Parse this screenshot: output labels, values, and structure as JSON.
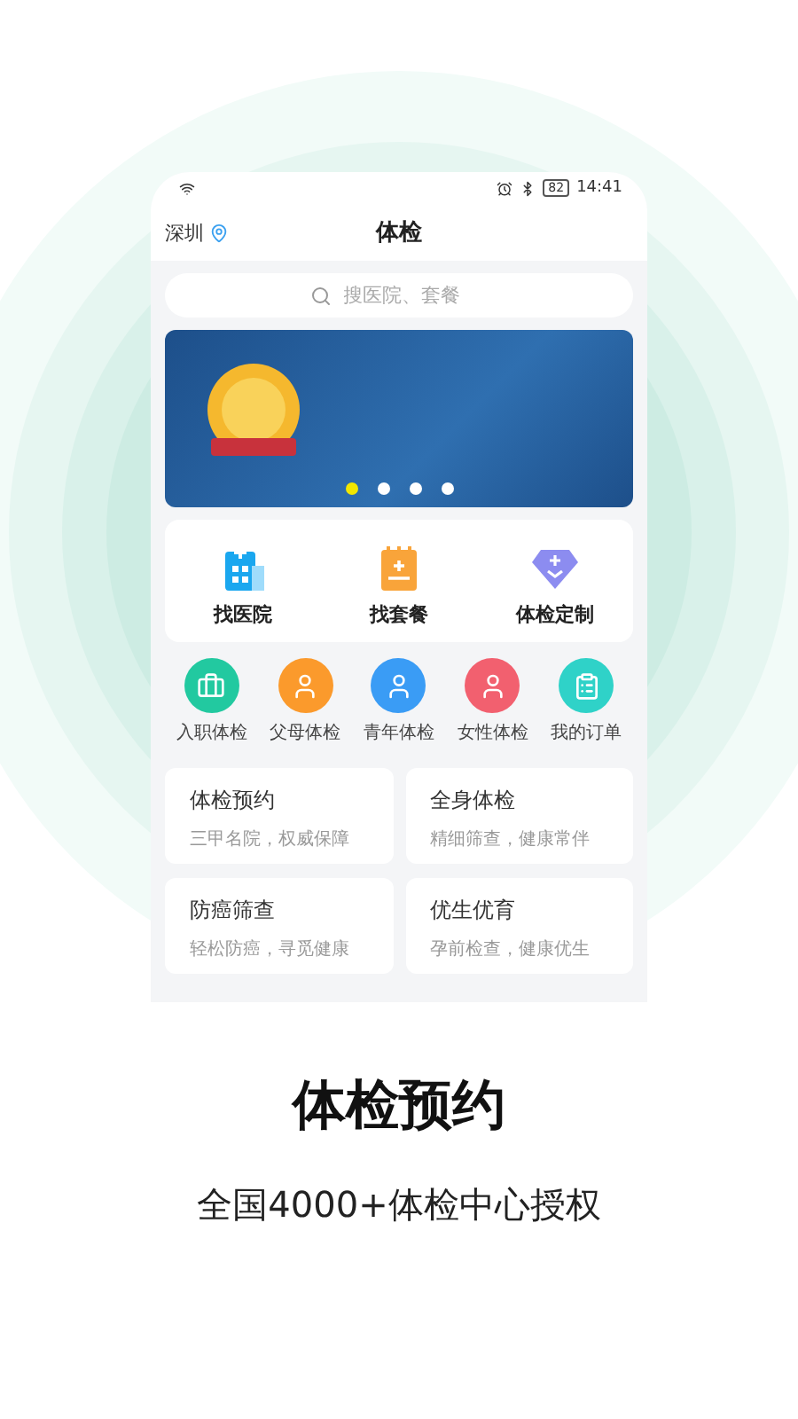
{
  "status_bar": {
    "battery": "82",
    "time": "14:41"
  },
  "header": {
    "city": "深圳",
    "title": "体检"
  },
  "search": {
    "placeholder": "搜医院、套餐"
  },
  "banner": {
    "dots": [
      {
        "selected": true
      },
      {
        "selected": false
      },
      {
        "selected": false
      },
      {
        "selected": false
      }
    ]
  },
  "quick_actions": [
    {
      "kind": "hospital",
      "label": "找医院"
    },
    {
      "kind": "package",
      "label": "找套餐"
    },
    {
      "kind": "custom",
      "label": "体检定制"
    }
  ],
  "categories": [
    {
      "kind": "job",
      "label": "入职体检",
      "color": "#22c9a0"
    },
    {
      "kind": "parent",
      "label": "父母体检",
      "color": "#fb9a2c"
    },
    {
      "kind": "youth",
      "label": "青年体检",
      "color": "#3a9cf5"
    },
    {
      "kind": "female",
      "label": "女性体检",
      "color": "#f2606f"
    },
    {
      "kind": "order",
      "label": "我的订单",
      "color": "#2fd2c8"
    }
  ],
  "services": [
    {
      "title": "体检预约",
      "subtitle": "三甲名院，权威保障"
    },
    {
      "title": "全身体检",
      "subtitle": "精细筛查，健康常伴"
    },
    {
      "title": "防癌筛查",
      "subtitle": "轻松防癌，寻觅健康"
    },
    {
      "title": "优生优育",
      "subtitle": "孕前检查，健康优生"
    }
  ],
  "caption": {
    "title": "体检预约",
    "subtitle": "全国4000+体检中心授权"
  }
}
